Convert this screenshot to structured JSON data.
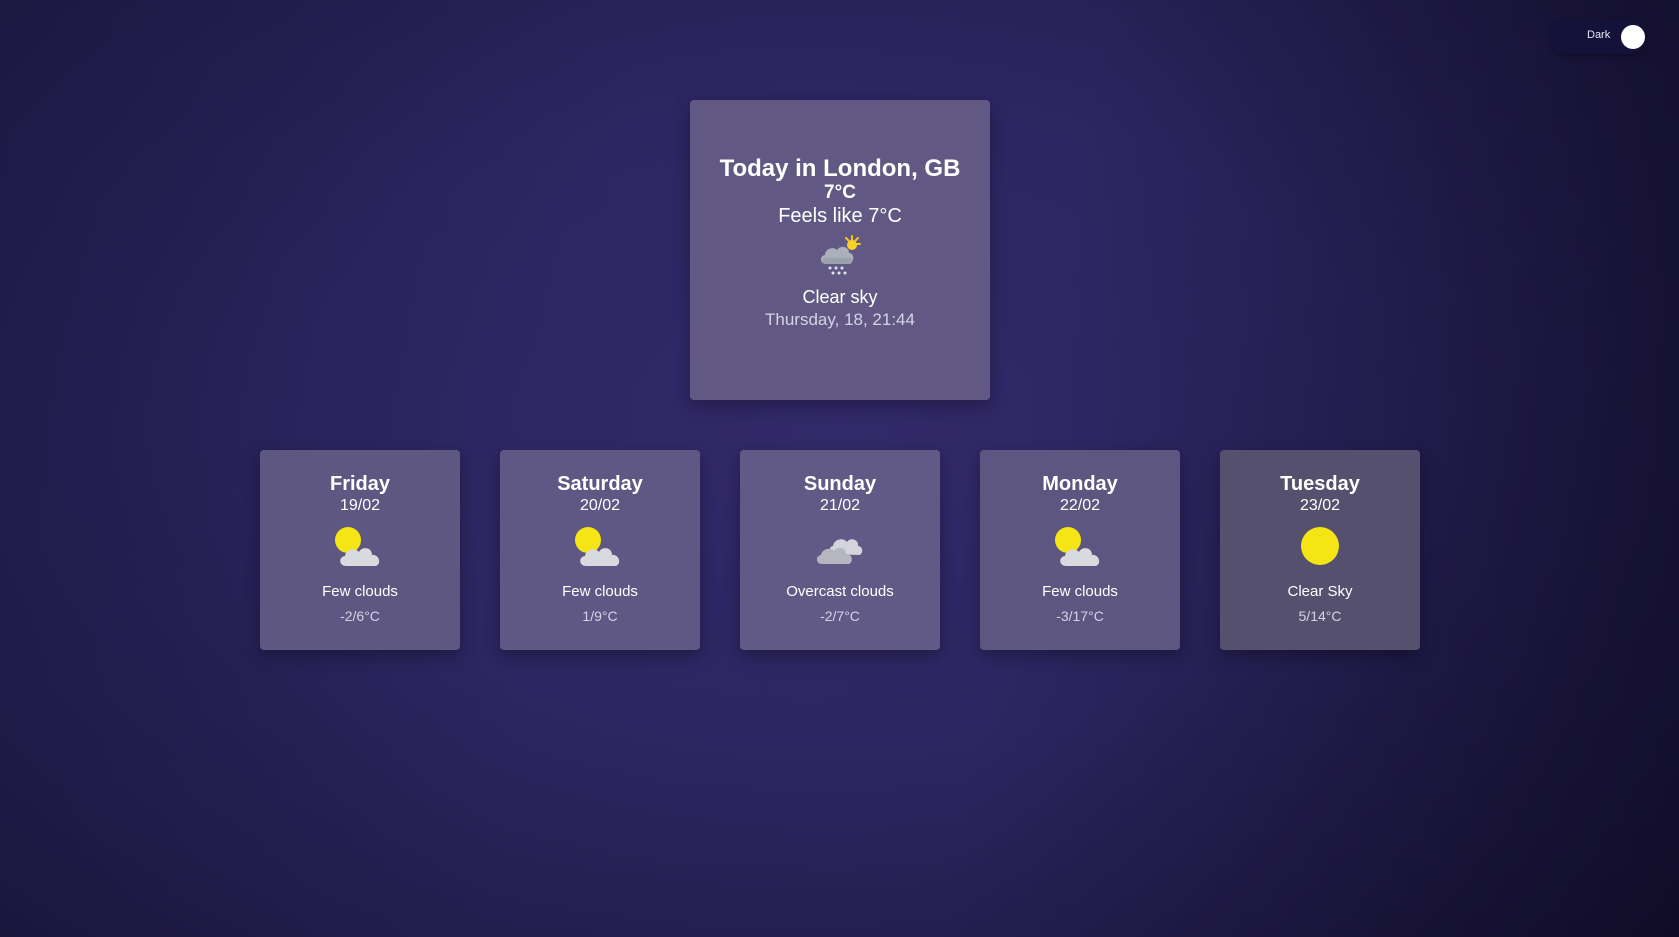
{
  "theme_toggle": {
    "label": "Dark"
  },
  "today": {
    "title": "Today in London, GB",
    "temperature": "7°C",
    "feels_like": "Feels like 7°C",
    "icon": "snow-cloud-sun-icon",
    "description": "Clear sky",
    "datetime": "Thursday, 18, 21:44"
  },
  "forecast": [
    {
      "day": "Friday",
      "date": "19/02",
      "icon": "sun-behind-cloud-icon",
      "description": "Few clouds",
      "temps": "-2/6°C",
      "card_color": "#5e5782"
    },
    {
      "day": "Saturday",
      "date": "20/02",
      "icon": "sun-behind-cloud-icon",
      "description": "Few clouds",
      "temps": "1/9°C",
      "card_color": "#5f5884"
    },
    {
      "day": "Sunday",
      "date": "21/02",
      "icon": "overcast-clouds-icon",
      "description": "Overcast clouds",
      "temps": "-2/7°C",
      "card_color": "#615a86"
    },
    {
      "day": "Monday",
      "date": "22/02",
      "icon": "sun-behind-cloud-icon",
      "description": "Few clouds",
      "temps": "-3/17°C",
      "card_color": "#5d5680"
    },
    {
      "day": "Tuesday",
      "date": "23/02",
      "icon": "sun-icon",
      "description": "Clear Sky",
      "temps": "5/14°C",
      "card_color": "#56506f"
    }
  ],
  "colors": {
    "sun": "#f6e514",
    "cloud": "#d9d9e0",
    "cloud_dark": "#bcbcc6"
  }
}
